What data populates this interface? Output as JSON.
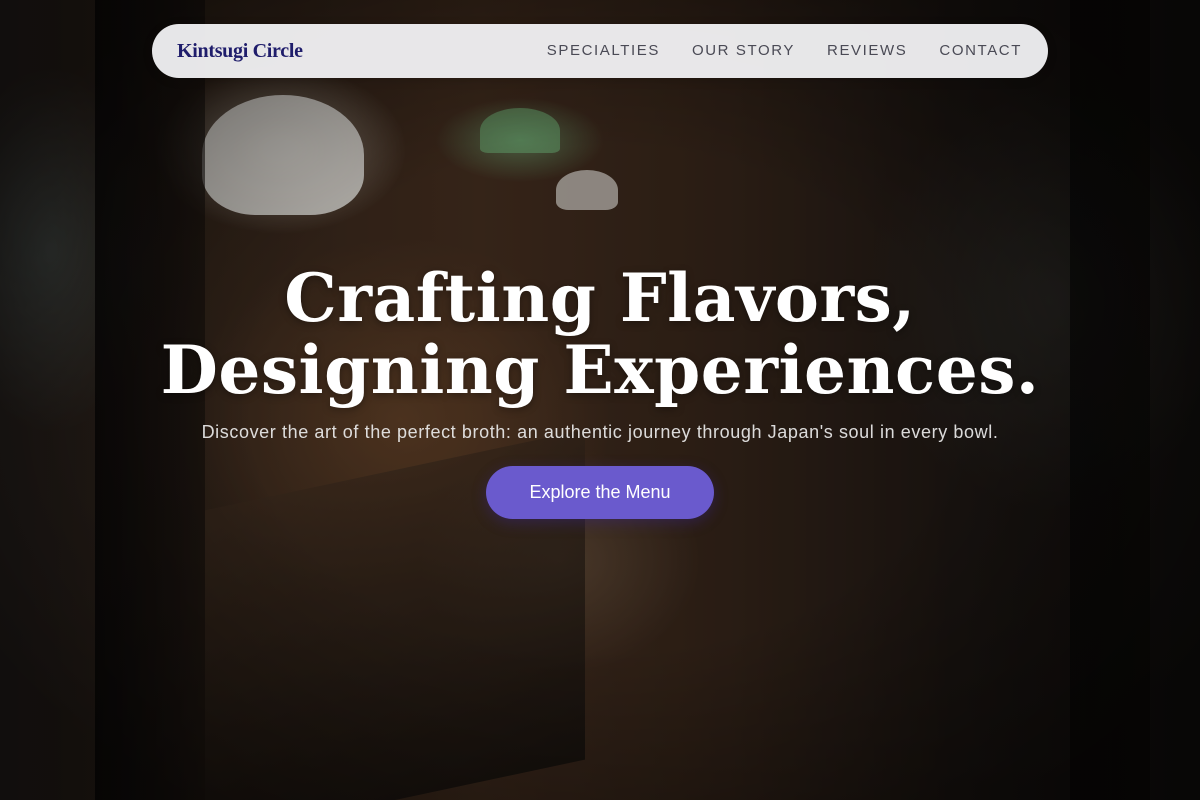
{
  "nav": {
    "brand": "Kintsugi Circle",
    "links": [
      {
        "label": "SPECIALTIES"
      },
      {
        "label": "OUR STORY"
      },
      {
        "label": "REVIEWS"
      },
      {
        "label": "CONTACT"
      }
    ]
  },
  "hero": {
    "title_line1": "Crafting Flavors,",
    "title_line2": "Designing Experiences.",
    "subtitle": "Discover the art of the perfect broth: an authentic journey through Japan's soul in every bowl.",
    "cta_label": "Explore the Menu"
  },
  "colors": {
    "brand": "#1f1d6b",
    "accent": "#6a5acd",
    "nav_bg": "#f4f4f6"
  }
}
